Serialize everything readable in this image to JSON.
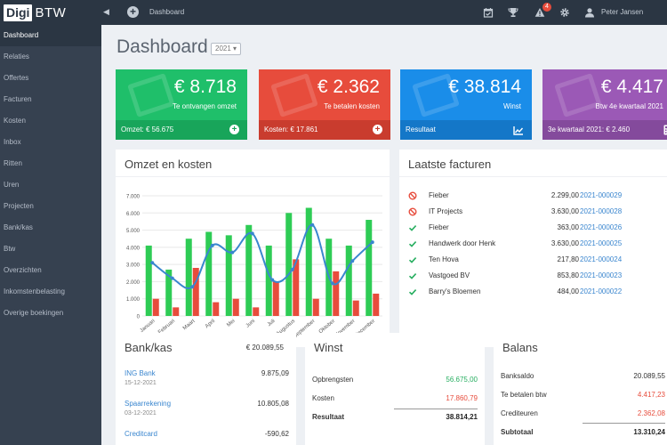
{
  "topbar": {
    "logo_a": "Digi",
    "logo_b": "BTW",
    "breadcrumb": "Dashboard",
    "notification_count": "4",
    "user_name": "Peter Jansen"
  },
  "sidebar": {
    "items": [
      {
        "label": "Dashboard",
        "active": true
      },
      {
        "label": "Relaties"
      },
      {
        "label": "Offertes"
      },
      {
        "label": "Facturen"
      },
      {
        "label": "Kosten"
      },
      {
        "label": "Inbox"
      },
      {
        "label": "Ritten"
      },
      {
        "label": "Uren"
      },
      {
        "label": "Projecten"
      },
      {
        "label": "Bank/kas"
      },
      {
        "label": "Btw"
      },
      {
        "label": "Overzichten"
      },
      {
        "label": "Inkomstenbelasting"
      },
      {
        "label": "Overige boekingen"
      }
    ]
  },
  "page": {
    "title": "Dashboard",
    "year": "2021"
  },
  "tiles": [
    {
      "value": "€ 8.718",
      "label": "Te ontvangen omzet",
      "footer": "Omzet: € 56.675",
      "color": "#1fbf6a",
      "footer_color": "#18a55a"
    },
    {
      "value": "€ 2.362",
      "label": "Te betalen kosten",
      "footer": "Kosten: € 17.861",
      "color": "#e74c3c",
      "footer_color": "#c93c2e"
    },
    {
      "value": "€ 38.814",
      "label": "Winst",
      "footer": "Resultaat",
      "color": "#1a8de9",
      "footer_color": "#1477c8"
    },
    {
      "value": "€ 4.417",
      "label": "Btw 4e kwartaal 2021",
      "footer": "3e kwartaal 2021: € 2.460",
      "color": "#9b59b6",
      "footer_color": "#844a9c"
    }
  ],
  "omzet_card": {
    "title": "Omzet en kosten"
  },
  "chart_data": {
    "type": "bar",
    "title": "Omzet en kosten",
    "categories": [
      "Januari",
      "Februari",
      "Maart",
      "April",
      "Mei",
      "Juni",
      "Juli",
      "Augustus",
      "September",
      "Oktober",
      "November",
      "December"
    ],
    "series": [
      {
        "values": [
          4100,
          2700,
          4500,
          4900,
          4700,
          5300,
          4100,
          6000,
          6300,
          4500,
          4100,
          5600
        ],
        "color": "#2ecc55"
      },
      {
        "values": [
          1000,
          500,
          2800,
          800,
          1000,
          500,
          2000,
          3300,
          1000,
          2600,
          900,
          1300
        ],
        "color": "#e74c3c"
      },
      {
        "type": "line",
        "values": [
          3100,
          2200,
          1700,
          4100,
          3700,
          4800,
          2100,
          2700,
          5300,
          1900,
          3200,
          4300
        ],
        "color": "#3a86cf"
      }
    ],
    "ylim": [
      0,
      7000
    ],
    "yticks": [
      "0",
      "1.000",
      "2.000",
      "3.000",
      "4.000",
      "5.000",
      "6.000",
      "7.000"
    ],
    "grid": true
  },
  "facturen_card": {
    "title": "Laatste facturen",
    "rows": [
      {
        "status": "blocked",
        "name": "Fieber",
        "amount": "2.299,00",
        "number": "2021-000029"
      },
      {
        "status": "blocked",
        "name": "IT Projects",
        "amount": "3.630,00",
        "number": "2021-000028"
      },
      {
        "status": "paid",
        "name": "Fieber",
        "amount": "363,00",
        "number": "2021-000026"
      },
      {
        "status": "paid",
        "name": "Handwerk door Henk",
        "amount": "3.630,00",
        "number": "2021-000025"
      },
      {
        "status": "paid",
        "name": "Ten Hova",
        "amount": "217,80",
        "number": "2021-000024"
      },
      {
        "status": "paid",
        "name": "Vastgoed BV",
        "amount": "853,80",
        "number": "2021-000023"
      },
      {
        "status": "paid",
        "name": "Barry's Bloemen",
        "amount": "484,00",
        "number": "2021-000022"
      }
    ]
  },
  "bank_card": {
    "title": "Bank/kas",
    "total": "€ 20.089,55",
    "accounts": [
      {
        "name": "ING Bank",
        "date": "15-12-2021",
        "amount": "9.875,09"
      },
      {
        "name": "Spaarrekening",
        "date": "03-12-2021",
        "amount": "10.805,08"
      },
      {
        "name": "Creditcard",
        "date": "",
        "amount": "-590,62"
      }
    ]
  },
  "winst_card": {
    "title": "Winst",
    "rows": [
      {
        "label": "Opbrengsten",
        "value": "56.675,00",
        "color": "#27ae60"
      },
      {
        "label": "Kosten",
        "value": "17.860,79",
        "color": "#e74c3c"
      },
      {
        "label": "Resultaat",
        "value": "38.814,21",
        "color": "#222",
        "bold": true
      }
    ]
  },
  "balans_card": {
    "title": "Balans",
    "rows": [
      {
        "label": "Banksaldo",
        "value": "20.089,55",
        "color": "#333"
      },
      {
        "label": "Te betalen btw",
        "value": "4.417,23",
        "color": "#e74c3c"
      },
      {
        "label": "Crediteuren",
        "value": "2.362,08",
        "color": "#e74c3c"
      },
      {
        "label": "Subtotaal",
        "value": "13.310,24",
        "color": "#222",
        "bold": true
      }
    ]
  },
  "icons": [
    "calendar-check-icon",
    "trophy-icon",
    "warning-icon",
    "gear-icon",
    "user-icon",
    "plus-circle-icon",
    "chart-line-icon",
    "calculator-icon",
    "ban-icon",
    "check-icon"
  ]
}
